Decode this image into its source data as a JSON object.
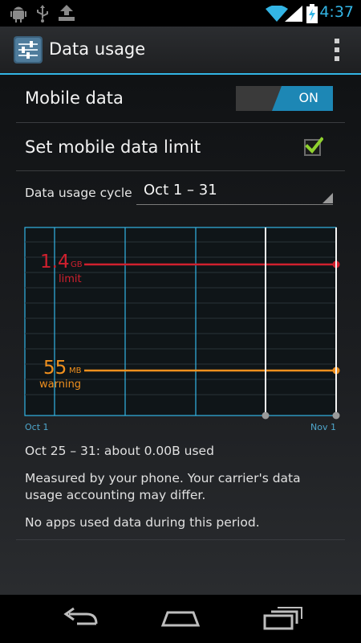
{
  "status_bar": {
    "time": "4:37",
    "left_icons": [
      "android-debug-icon",
      "usb-icon",
      "download-icon"
    ],
    "right_icons": [
      "wifi-icon",
      "signal-icon",
      "battery-charging-icon"
    ],
    "accent": "#33b5e5"
  },
  "action_bar": {
    "title": "Data usage",
    "icon": "settings-sliders-icon",
    "overflow_icon": "overflow-menu-icon"
  },
  "mobile_data": {
    "label": "Mobile data",
    "toggle_label": "ON",
    "state": true
  },
  "data_limit": {
    "label": "Set mobile data limit",
    "checked": true
  },
  "cycle": {
    "label": "Data usage cycle",
    "value": "Oct 1 – 31"
  },
  "chart": {
    "limit": {
      "value": "1.4",
      "unit": "GB",
      "label": "limit",
      "color": "#d0202e"
    },
    "warning": {
      "value": "55",
      "unit": "MB",
      "label": "warning",
      "color": "#f0901e"
    },
    "start_label": "Oct 1",
    "end_label": "Nov 1",
    "grid_color": "#33b5e5"
  },
  "summary": {
    "usage": "Oct 25 – 31: about 0.00B used",
    "note_line1": "Measured by your phone. Your carrier's data",
    "note_line2": "usage accounting may differ.",
    "apps": "No apps used data during this period."
  },
  "nav_bar": {
    "back_icon": "back-icon",
    "home_icon": "home-icon",
    "recents_icon": "recent-apps-icon"
  }
}
